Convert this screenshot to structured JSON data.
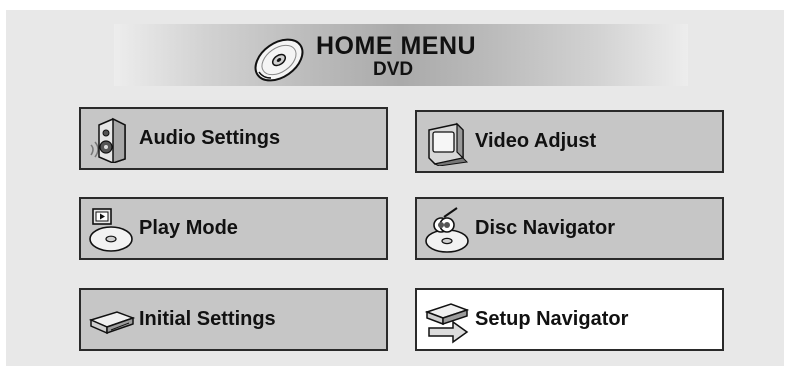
{
  "header": {
    "title": "HOME MENU",
    "subtitle": "DVD",
    "icon": "disc-icon"
  },
  "menu": {
    "items": [
      {
        "label": "Audio Settings",
        "icon": "speaker-icon",
        "selected": false
      },
      {
        "label": "Video Adjust",
        "icon": "tv-icon",
        "selected": false
      },
      {
        "label": "Play Mode",
        "icon": "play-mode-disc-icon",
        "selected": false
      },
      {
        "label": "Disc Navigator",
        "icon": "disc-navigator-icon",
        "selected": false
      },
      {
        "label": "Initial Settings",
        "icon": "player-device-icon",
        "selected": false
      },
      {
        "label": "Setup Navigator",
        "icon": "setup-navigator-icon",
        "selected": true
      }
    ]
  },
  "colors": {
    "panel_background": "#e8e8e8",
    "button_background": "#c6c6c6",
    "selected_button_background": "#ffffff",
    "border": "#2a2a2a",
    "text": "#111111"
  }
}
